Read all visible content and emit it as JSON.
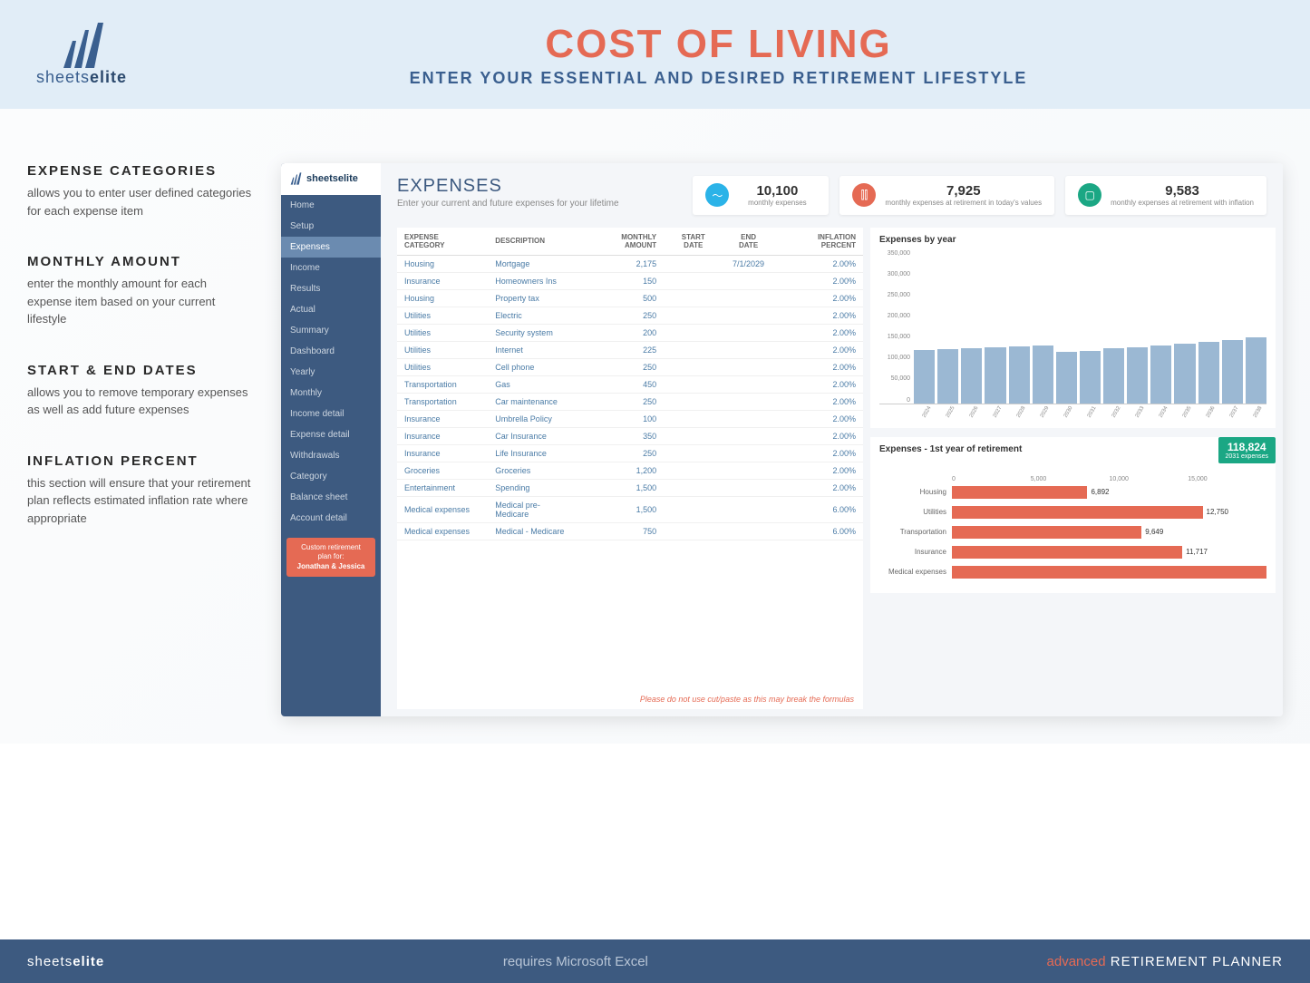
{
  "brand": {
    "name_light": "sheets",
    "name_bold": "elite"
  },
  "banner": {
    "title": "COST OF LIVING",
    "subtitle": "ENTER YOUR ESSENTIAL AND DESIRED RETIREMENT LIFESTYLE"
  },
  "features": [
    {
      "title": "EXPENSE CATEGORIES",
      "desc": "allows you to enter user defined categories for each expense item"
    },
    {
      "title": "MONTHLY AMOUNT",
      "desc": "enter the monthly amount for each expense item based on your current lifestyle"
    },
    {
      "title": "START & END DATES",
      "desc": "allows you to remove temporary expenses as well as add future expenses"
    },
    {
      "title": "INFLATION PERCENT",
      "desc": "this section will ensure that your retirement plan reflects estimated inflation rate where appropriate"
    }
  ],
  "sidebar": {
    "items": [
      "Home",
      "Setup",
      "Expenses",
      "Income",
      "Results",
      "Actual",
      "Summary",
      "Dashboard",
      "Yearly",
      "Monthly",
      "Income detail",
      "Expense detail",
      "Withdrawals",
      "Category",
      "Balance sheet",
      "Account detail"
    ],
    "active_index": 2,
    "badge": {
      "line1": "Custom retirement",
      "line2": "plan for:",
      "names": "Jonathan & Jessica"
    }
  },
  "content_header": {
    "title": "EXPENSES",
    "sub": "Enter your current and future expenses for your lifetime"
  },
  "stats": [
    {
      "icon": "chart-line-icon",
      "color": "blue",
      "value": "10,100",
      "label": "monthly expenses"
    },
    {
      "icon": "bars-icon",
      "color": "orange",
      "value": "7,925",
      "label": "monthly expenses at retirement in today's values"
    },
    {
      "icon": "display-icon",
      "color": "green",
      "value": "9,583",
      "label": "monthly expenses at retirement with inflation"
    }
  ],
  "table": {
    "headers": [
      "EXPENSE CATEGORY",
      "DESCRIPTION",
      "MONTHLY AMOUNT",
      "START DATE",
      "END DATE",
      "INFLATION PERCENT"
    ],
    "rows": [
      [
        "Housing",
        "Mortgage",
        "2,175",
        "",
        "7/1/2029",
        "2.00%"
      ],
      [
        "Insurance",
        "Homeowners Ins",
        "150",
        "",
        "",
        "2.00%"
      ],
      [
        "Housing",
        "Property tax",
        "500",
        "",
        "",
        "2.00%"
      ],
      [
        "Utilities",
        "Electric",
        "250",
        "",
        "",
        "2.00%"
      ],
      [
        "Utilities",
        "Security system",
        "200",
        "",
        "",
        "2.00%"
      ],
      [
        "Utilities",
        "Internet",
        "225",
        "",
        "",
        "2.00%"
      ],
      [
        "Utilities",
        "Cell phone",
        "250",
        "",
        "",
        "2.00%"
      ],
      [
        "Transportation",
        "Gas",
        "450",
        "",
        "",
        "2.00%"
      ],
      [
        "Transportation",
        "Car maintenance",
        "250",
        "",
        "",
        "2.00%"
      ],
      [
        "Insurance",
        "Umbrella Policy",
        "100",
        "",
        "",
        "2.00%"
      ],
      [
        "Insurance",
        "Car Insurance",
        "350",
        "",
        "",
        "2.00%"
      ],
      [
        "Insurance",
        "Life Insurance",
        "250",
        "",
        "",
        "2.00%"
      ],
      [
        "Groceries",
        "Groceries",
        "1,200",
        "",
        "",
        "2.00%"
      ],
      [
        "Entertainment",
        "Spending",
        "1,500",
        "",
        "",
        "2.00%"
      ],
      [
        "Medical expenses",
        "Medical pre-Medicare",
        "1,500",
        "",
        "",
        "6.00%"
      ],
      [
        "Medical expenses",
        "Medical - Medicare",
        "750",
        "",
        "",
        "6.00%"
      ]
    ],
    "footer": "Please do not use cut/paste as this may break the formulas"
  },
  "chart_data": [
    {
      "type": "bar",
      "title": "Expenses by year",
      "ylabel": "",
      "ylim": [
        0,
        350000
      ],
      "y_ticks": [
        "350,000",
        "300,000",
        "250,000",
        "200,000",
        "150,000",
        "100,000",
        "50,000",
        "0"
      ],
      "categories": [
        "2024",
        "2025",
        "2026",
        "2027",
        "2028",
        "2029",
        "2030",
        "2031",
        "2032",
        "2033",
        "2034",
        "2035",
        "2036",
        "2037",
        "2038"
      ],
      "values": [
        122000,
        124000,
        126000,
        128000,
        130000,
        132000,
        118000,
        120000,
        125000,
        128000,
        132000,
        136000,
        140000,
        145000,
        150000
      ]
    },
    {
      "type": "bar",
      "orientation": "horizontal",
      "title": "Expenses - 1st year of retirement",
      "badge": {
        "value": "118,824",
        "label": "2031 expenses"
      },
      "xlim": [
        0,
        16000
      ],
      "x_ticks": [
        "0",
        "5,000",
        "10,000",
        "15,000"
      ],
      "categories": [
        "Housing",
        "Utilities",
        "Transportation",
        "Insurance",
        "Medical expenses"
      ],
      "values": [
        6892,
        12750,
        9649,
        11717,
        16000
      ],
      "value_labels": [
        "6,892",
        "12,750",
        "9,649",
        "11,717",
        ""
      ]
    }
  ],
  "bottom": {
    "left_light": "sheets",
    "left_bold": "elite",
    "center": "requires Microsoft Excel",
    "right_adv": "advanced",
    "right_rp": " RETIREMENT PLANNER"
  }
}
